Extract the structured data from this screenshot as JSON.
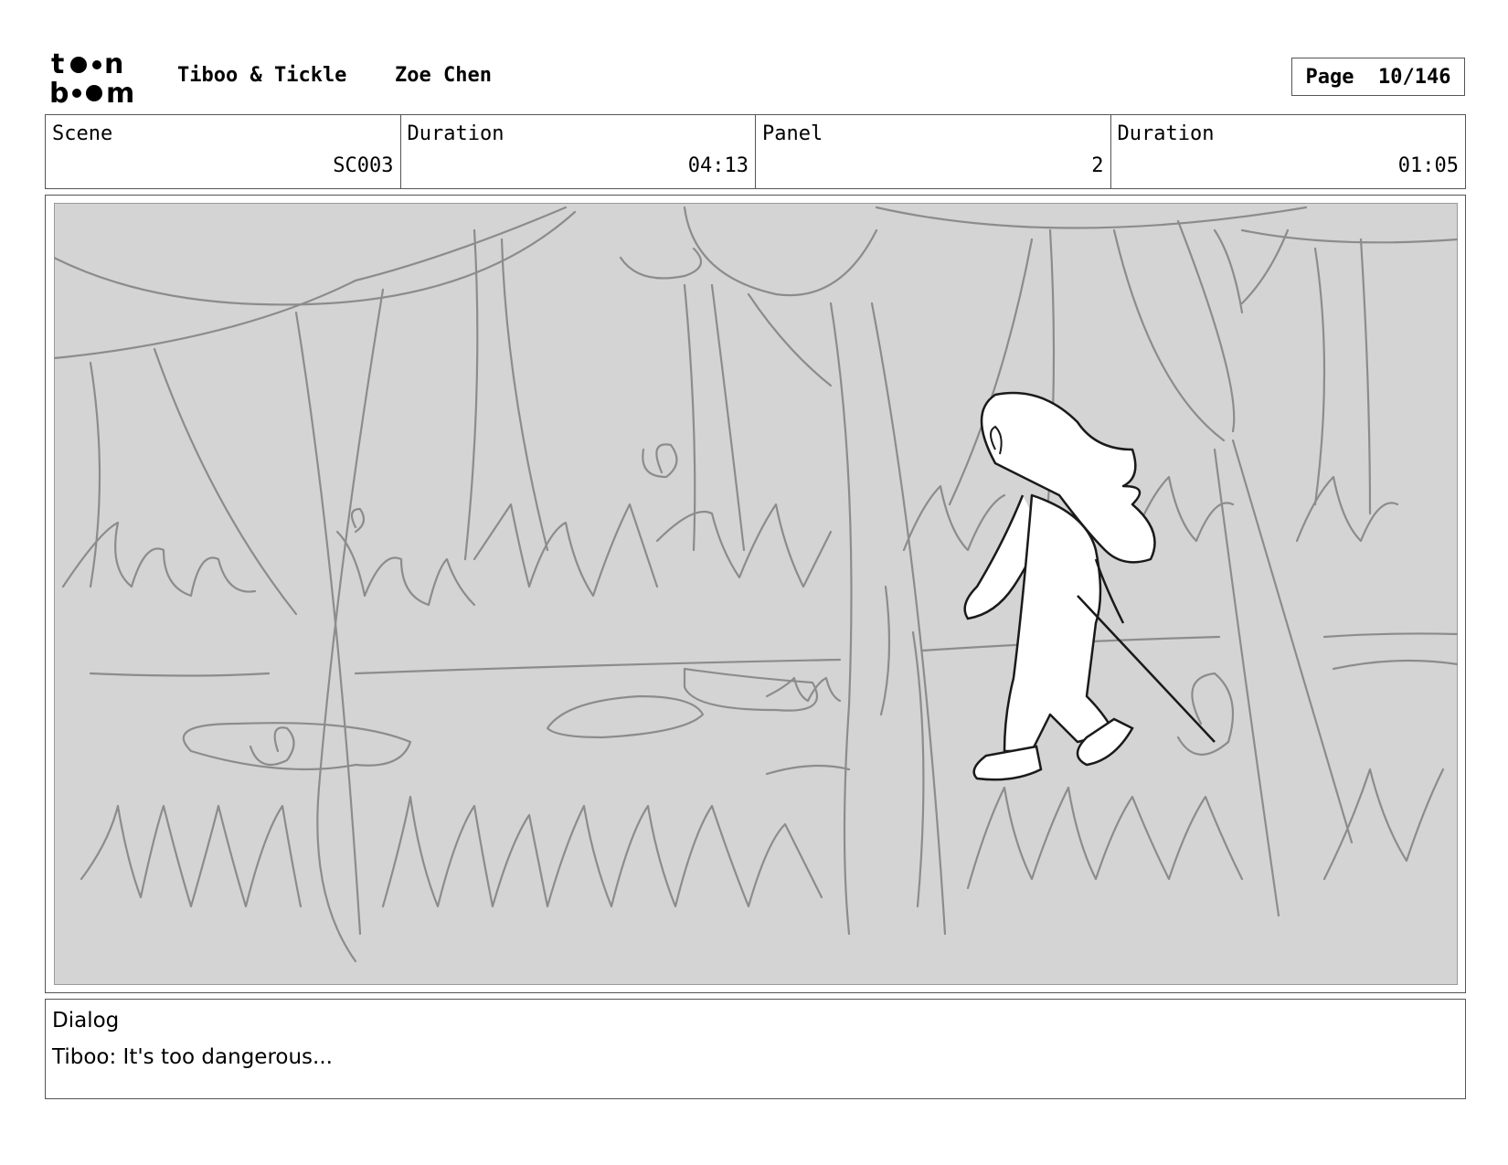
{
  "header": {
    "logo_text": "toon boom",
    "project": "Tiboo & Tickle",
    "author": "Zoe Chen",
    "page_label": "Page",
    "page_number": "10/146"
  },
  "info": {
    "scene_label": "Scene",
    "scene_value": "SC003",
    "scene_duration_label": "Duration",
    "scene_duration_value": "04:13",
    "panel_label": "Panel",
    "panel_value": "2",
    "panel_duration_label": "Duration",
    "panel_duration_value": "01:05"
  },
  "panel": {
    "background_color": "#d4d4d4",
    "line_color": "#8c8c8c",
    "character_line_color": "#1a1a1a",
    "character_fill_color": "#ffffff"
  },
  "dialog": {
    "label": "Dialog",
    "text": "Tiboo: It's too dangerous..."
  }
}
